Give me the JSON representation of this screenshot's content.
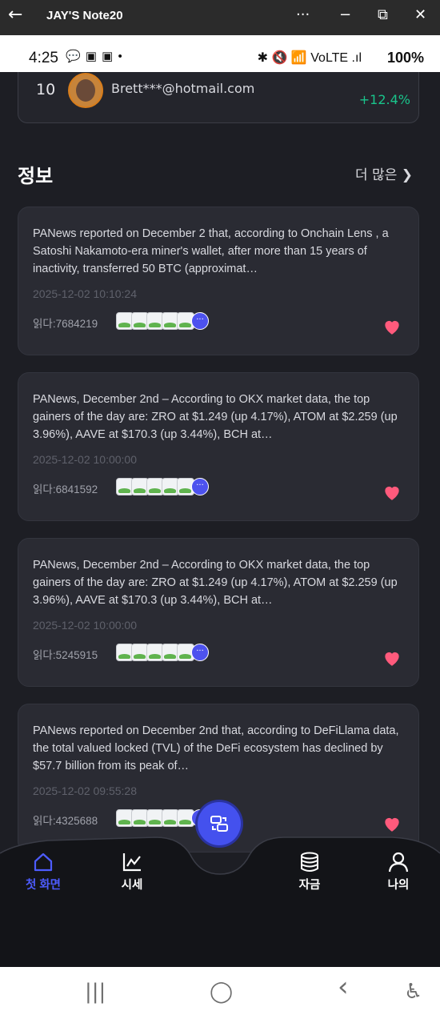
{
  "window": {
    "title": "JAY'S Note20",
    "back_glyph": "←",
    "menu_glyph": "···",
    "minimize_glyph": "−",
    "restore_glyph": "⧉",
    "close_glyph": "✕"
  },
  "status_bar": {
    "time": "4:25",
    "left_icons": "💬 ▣ ▣ •",
    "right_icons": "✱ 🔇 📶 VoLTE .ıl",
    "battery": "100%"
  },
  "ranking": {
    "rank": "10",
    "email": "Brett***@hotmail.com",
    "change": "+12.4%"
  },
  "info_section": {
    "title": "정보",
    "more_label": "더 많은 ❯"
  },
  "news": [
    {
      "text": "PANews reported on December 2 that, according to Onchain Lens , a Satoshi Nakamoto-era miner's wallet, after more than 15 years of inactivity, transferred 50 BTC (approximat…",
      "date": "2025-12-02 10:10:24",
      "reads": "읽다:7684219",
      "more": "···"
    },
    {
      "text": "PANews, December 2nd – According to OKX market data, the top gainers of the day are: ZRO at $1.249 (up 4.17%), ATOM at $2.259 (up 3.96%), AAVE at $170.3 (up 3.44%), BCH at…",
      "date": "2025-12-02 10:00:00",
      "reads": "읽다:6841592",
      "more": "···"
    },
    {
      "text": "PANews, December 2nd – According to OKX market data, the top gainers of the day are: ZRO at $1.249 (up 4.17%), ATOM at $2.259 (up 3.96%), AAVE at $170.3 (up 3.44%), BCH at…",
      "date": "2025-12-02 10:00:00",
      "reads": "읽다:5245915",
      "more": "···"
    },
    {
      "text": "PANews reported on December 2nd that, according to DeFiLlama data, the total valued locked (TVL) of the DeFi ecosystem has declined by $57.7 billion from its peak of…",
      "date": "2025-12-02 09:55:28",
      "reads": "읽다:4325688",
      "more": "···"
    }
  ],
  "bottom_nav": [
    {
      "label": "첫 화면",
      "icon": "home-icon",
      "active": true
    },
    {
      "label": "시세",
      "icon": "chart-icon",
      "active": false
    },
    {
      "label": "자금",
      "icon": "coins-icon",
      "active": false
    },
    {
      "label": "나의",
      "icon": "user-icon",
      "active": false
    }
  ],
  "system_nav": {
    "recent": "|||",
    "home": "◯",
    "back": "‹",
    "accessibility": "♿"
  },
  "colors": {
    "accent": "#4451ee",
    "positive": "#19c48b",
    "heart": "#ff5a7c",
    "background": "#1d1e24",
    "card": "#2a2b33"
  }
}
